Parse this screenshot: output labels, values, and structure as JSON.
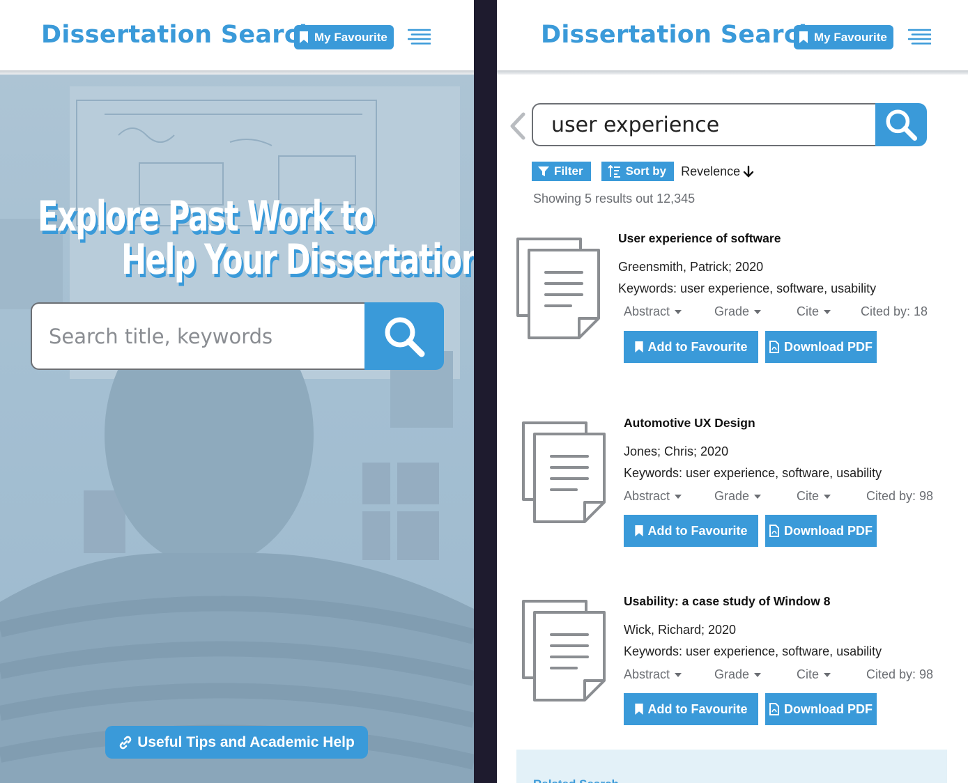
{
  "home": {
    "brand": "Dissertation Search",
    "favourite_label": "My Favourite",
    "headline_line1": "Explore Past Work to",
    "headline_line2": "Help Your Dissertation",
    "search_placeholder": "Search title, keywords",
    "tips_label": "Useful Tips and Academic Help"
  },
  "results_page": {
    "brand": "Dissertation Search",
    "favourite_label": "My Favourite",
    "query": "user experience",
    "filter_label": "Filter",
    "sort_label": "Sort by",
    "sort_value": "Revelence",
    "count_text": "Showing 5 results out 12,345",
    "related_label": "Related Search",
    "results": [
      {
        "title": "User experience of software",
        "author": "Greensmith, Patrick; 2020",
        "keywords": "Keywords: user experience, software, usability",
        "abstract": "Abstract",
        "grade": "Grade",
        "cite": "Cite",
        "cited_by": "Cited by: 18",
        "add_label": "Add to Favourite",
        "download_label": "Download PDF"
      },
      {
        "title": "Automotive UX Design",
        "author": "Jones; Chris; 2020",
        "keywords": "Keywords: user experience, software, usability",
        "abstract": "Abstract",
        "grade": "Grade",
        "cite": "Cite",
        "cited_by": "Cited by: 98",
        "add_label": "Add to Favourite",
        "download_label": "Download PDF"
      },
      {
        "title": "Usability: a case study of  Window 8",
        "author": "Wick, Richard; 2020",
        "keywords": "Keywords: user experience, software, usability",
        "abstract": "Abstract",
        "grade": "Grade",
        "cite": "Cite",
        "cited_by": "Cited by: 98",
        "add_label": "Add to Favourite",
        "download_label": "Download PDF"
      }
    ]
  },
  "icons": {
    "bookmark": "bookmark-icon",
    "menu": "hamburger-menu-icon",
    "search": "search-icon",
    "link": "link-icon",
    "filter": "filter-icon",
    "sort": "sort-icon",
    "pdf": "pdf-file-icon",
    "document": "document-icon",
    "back": "chevron-left-icon"
  },
  "colors": {
    "accent": "#3a9ad9",
    "hero_tint": "#a4bfd2",
    "panel": "#e3f1f8",
    "divider": "#1e1b2e"
  }
}
